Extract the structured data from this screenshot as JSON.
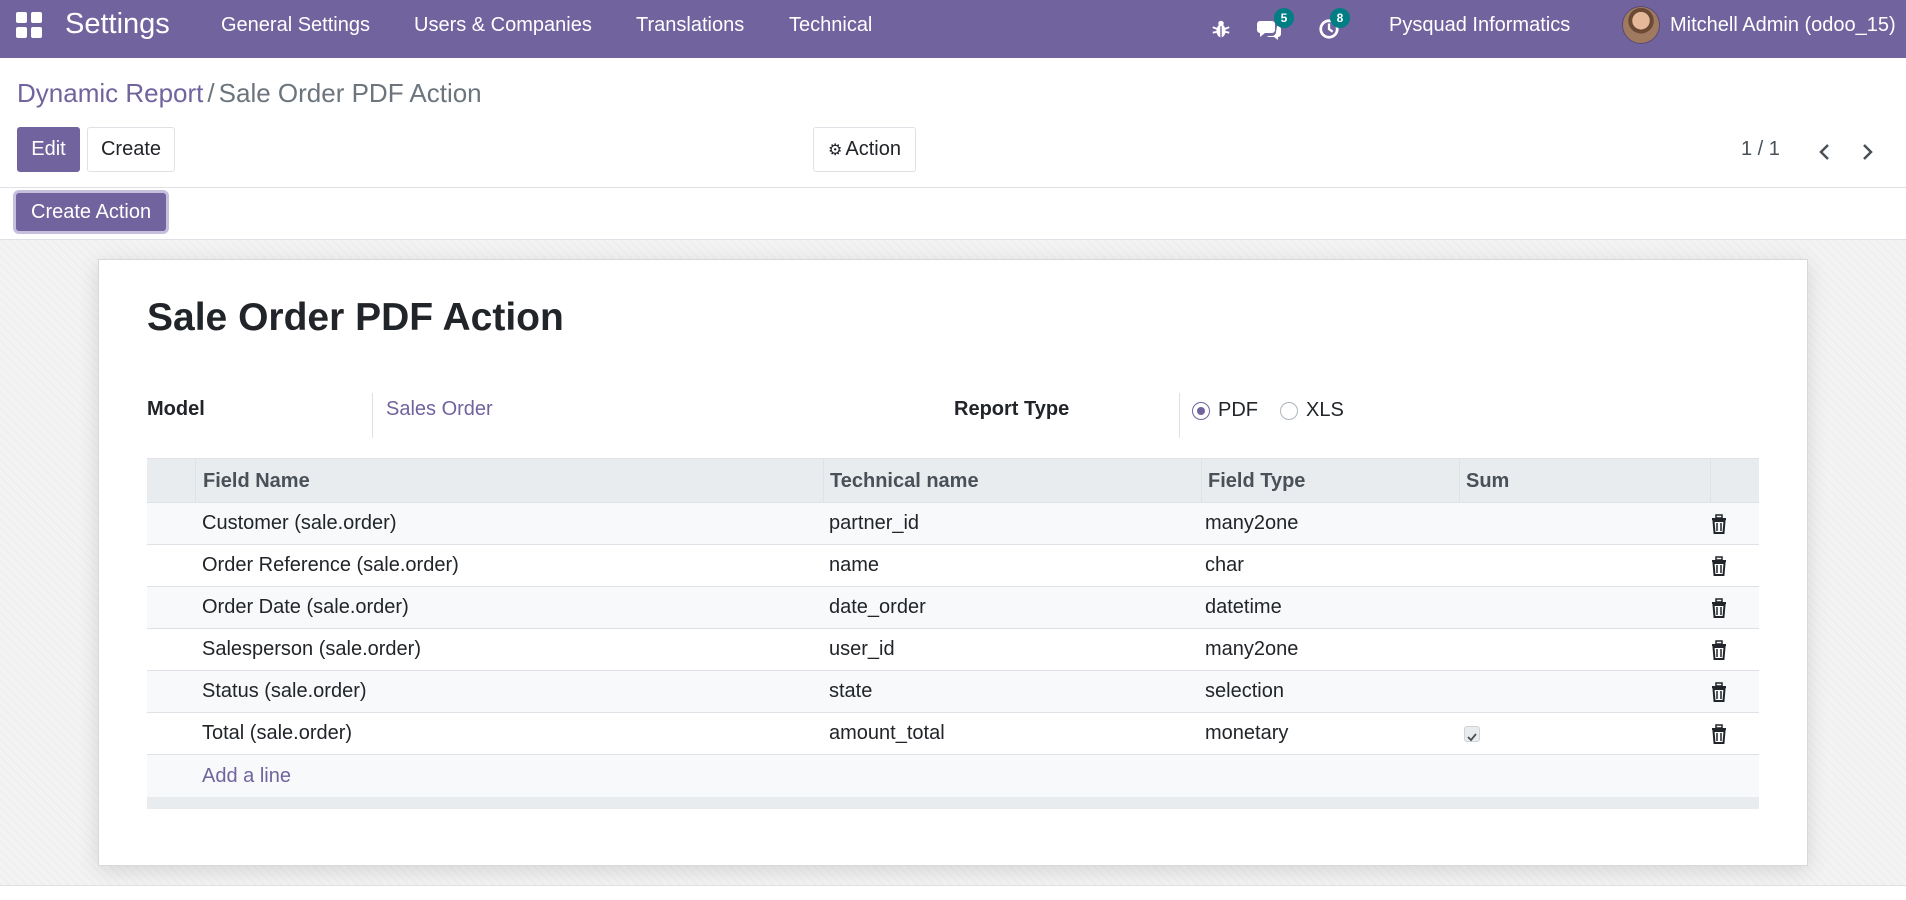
{
  "navbar": {
    "brand": "Settings",
    "menus": [
      "General Settings",
      "Users & Companies",
      "Translations",
      "Technical"
    ],
    "messages_count": "5",
    "activities_count": "8",
    "company": "Pysquad Informatics",
    "user": "Mitchell Admin (odoo_15)"
  },
  "breadcrumb": {
    "parent": "Dynamic Report",
    "separator": "/",
    "current": "Sale Order PDF Action"
  },
  "buttons": {
    "edit": "Edit",
    "create": "Create",
    "action": "Action",
    "create_action": "Create Action"
  },
  "pager": {
    "value": "1 / 1"
  },
  "form": {
    "title": "Sale Order PDF Action",
    "model_label": "Model",
    "model_value": "Sales Order",
    "report_type_label": "Report Type",
    "report_type_options": [
      "PDF",
      "XLS"
    ],
    "report_type_selected": "PDF"
  },
  "table": {
    "headers": [
      "Field Name",
      "Technical name",
      "Field Type",
      "Sum"
    ],
    "rows": [
      {
        "field_name": "Customer (sale.order)",
        "technical_name": "partner_id",
        "field_type": "many2one",
        "sum": false
      },
      {
        "field_name": "Order Reference (sale.order)",
        "technical_name": "name",
        "field_type": "char",
        "sum": false
      },
      {
        "field_name": "Order Date (sale.order)",
        "technical_name": "date_order",
        "field_type": "datetime",
        "sum": false
      },
      {
        "field_name": "Salesperson (sale.order)",
        "technical_name": "user_id",
        "field_type": "many2one",
        "sum": false
      },
      {
        "field_name": "Status (sale.order)",
        "technical_name": "state",
        "field_type": "selection",
        "sum": false
      },
      {
        "field_name": "Total (sale.order)",
        "technical_name": "amount_total",
        "field_type": "monetary",
        "sum": true
      }
    ],
    "add_line": "Add a line"
  },
  "colors": {
    "brand": "#71639e",
    "badge": "#017e84"
  }
}
